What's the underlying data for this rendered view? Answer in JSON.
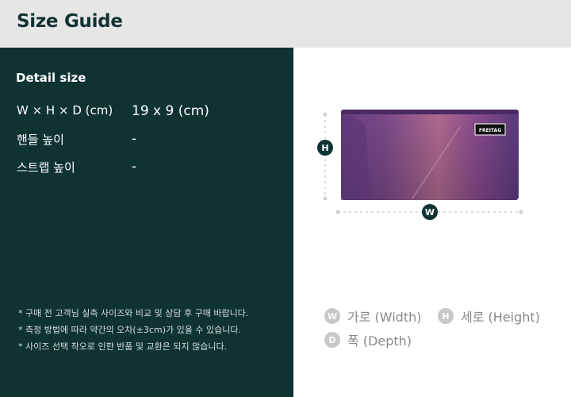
{
  "header": {
    "title": "Size Guide"
  },
  "detail": {
    "title": "Detail size",
    "rows": [
      {
        "label": "W × H × D (cm)",
        "value": "19 x 9 (cm)"
      },
      {
        "label": "핸들 높이",
        "value": "-"
      },
      {
        "label": "스트랩 높이",
        "value": "-"
      }
    ],
    "notes": [
      "* 구매 전 고객님 실측 사이즈와 비교 및 상담 후 구매 바랍니다.",
      "* 측정 방법에 따라 약간의 오차(±3cm)가 있을 수 있습니다.",
      "* 사이즈 선택 착오로 인한 반품 및 교환은 되지 않습니다."
    ]
  },
  "diagram": {
    "h_badge": "H",
    "w_badge": "W",
    "brand_label": "FREITAG"
  },
  "legend": {
    "w": {
      "badge": "W",
      "label": "가로 (Width)"
    },
    "h": {
      "badge": "H",
      "label": "세로 (Height)"
    },
    "d": {
      "badge": "D",
      "label": "폭 (Depth)"
    }
  },
  "colors": {
    "dark_panel": "#0f3232",
    "header_bg": "#e6e6e6",
    "legend_gray": "#c8c8c8"
  }
}
